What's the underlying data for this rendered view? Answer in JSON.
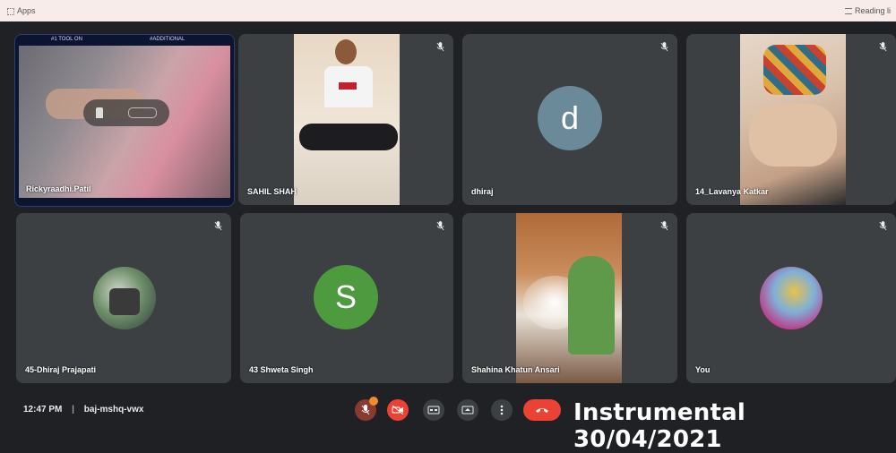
{
  "browser": {
    "apps_label": "Apps",
    "reading_label": "Reading li"
  },
  "colors": {
    "tile_bg": "#3c4043",
    "stage_bg": "#202124",
    "danger": "#ea4335",
    "avatar_d": "#6b8a99",
    "avatar_s": "#4e9a3e"
  },
  "participants": [
    {
      "name": "Rickyraadhi.Patil",
      "type": "video"
    },
    {
      "name": "SAHIL SHAH",
      "type": "video"
    },
    {
      "name": "dhiraj",
      "type": "letter",
      "letter": "d"
    },
    {
      "name": "14_Lavanya Katkar",
      "type": "video"
    },
    {
      "name": "45-Dhiraj Prajapati",
      "type": "photo"
    },
    {
      "name": "43 Shweta Singh",
      "type": "letter",
      "letter": "S"
    },
    {
      "name": "Shahina Khatun Ansari",
      "type": "video"
    },
    {
      "name": "You",
      "type": "photo"
    }
  ],
  "presenter_overlay": {
    "top_left": "#1 TOOL ON",
    "top_right": "#ADDITIONAL"
  },
  "meeting": {
    "time": "12:47 PM",
    "separator": "|",
    "code": "baj-mshq-vwx"
  },
  "watermark": "Instrumental 30/04/2021",
  "icons": [
    "mic-off-icon",
    "camera-off-icon",
    "captions-icon",
    "present-icon",
    "more-icon",
    "hang-up-icon"
  ]
}
